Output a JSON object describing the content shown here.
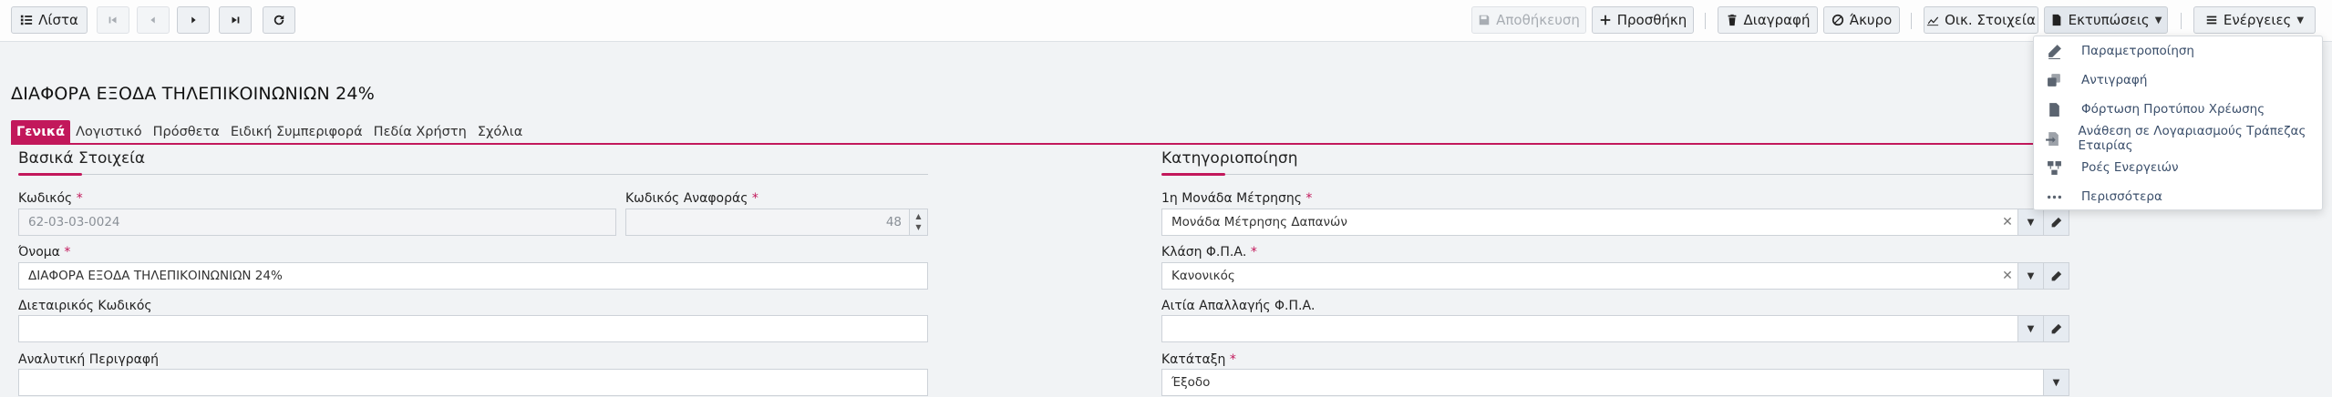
{
  "toolbar": {
    "list_label": "Λίστα",
    "save_label": "Αποθήκευση",
    "add_label": "Προσθήκη",
    "delete_label": "Διαγραφή",
    "cancel_label": "Άκυρο",
    "financial_label": "Οικ. Στοιχεία",
    "prints_label": "Εκτυπώσεις",
    "actions_label": "Ενέργειες"
  },
  "page": {
    "title": "ΔΙΑΦΟΡΑ ΕΞΟΔΑ ΤΗΛΕΠΙΚΟΙΝΩΝΙΩΝ 24%"
  },
  "tabs": [
    {
      "label": "Γενικά",
      "active": true
    },
    {
      "label": "Λογιστικό"
    },
    {
      "label": "Πρόσθετα"
    },
    {
      "label": "Ειδική Συμπεριφορά"
    },
    {
      "label": "Πεδία Χρήστη"
    },
    {
      "label": "Σχόλια"
    }
  ],
  "basic": {
    "title": "Βασικά Στοιχεία",
    "code_label": "Κωδικός",
    "code_value": "62-03-03-0024",
    "ref_code_label": "Κωδικός Αναφοράς",
    "ref_code_value": "48",
    "name_label": "Όνομα",
    "name_value": "ΔΙΑΦΟΡΑ ΕΞΟΔΑ ΤΗΛΕΠΙΚΟΙΝΩΝΙΩΝ 24%",
    "intl_code_label": "Διεταιρικός Κωδικός",
    "intl_code_value": "",
    "description_label": "Αναλυτική Περιγραφή",
    "description_value": ""
  },
  "classification": {
    "title": "Κατηγοριοποίηση",
    "unit_label": "1η Μονάδα Μέτρησης",
    "unit_value": "Μονάδα Μέτρησης Δαπανών",
    "vat_class_label": "Κλάση Φ.Π.Α.",
    "vat_class_value": "Κανονικός",
    "vat_exempt_label": "Αιτία Απαλλαγής Φ.Π.Α.",
    "vat_exempt_value": "",
    "category_label": "Κατάταξη",
    "category_value": "Έξοδο"
  },
  "required_mark": "*",
  "actions_menu": {
    "items": [
      {
        "label": "Παραμετροποίηση",
        "icon": "edit-icon"
      },
      {
        "label": "Αντιγραφή",
        "icon": "copy-icon"
      },
      {
        "label": "Φόρτωση Προτύπου Χρέωσης",
        "icon": "template-icon"
      },
      {
        "label": "Ανάθεση σε Λογαριασμούς Τράπεζας Εταιρίας",
        "icon": "assign-icon"
      },
      {
        "label": "Ροές Ενεργειών",
        "icon": "workflow-icon"
      },
      {
        "label": "Περισσότερα",
        "icon": "more-icon"
      }
    ]
  },
  "colors": {
    "accent": "#c2185b",
    "menu_text": "#3b4f6b"
  }
}
